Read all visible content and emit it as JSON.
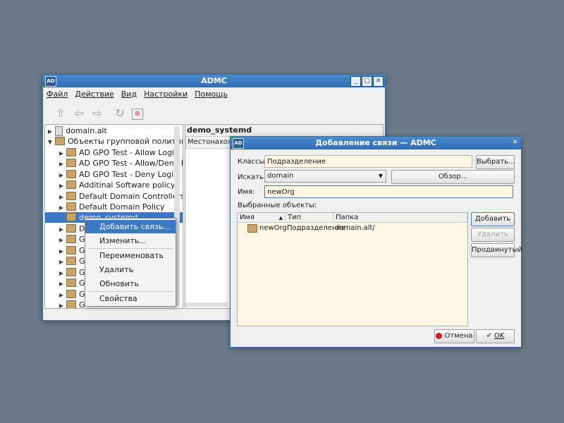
{
  "main_window": {
    "icon": "AD",
    "title": "ADMC",
    "controls": [
      "minimize",
      "maximize",
      "close"
    ],
    "menu": [
      "Файл",
      "Действие",
      "Вид",
      "Настройки",
      "Помощь"
    ],
    "toolbar": [
      "up-arrow-icon",
      "back-arrow-icon",
      "forward-arrow-icon",
      "refresh-icon",
      "filter-icon"
    ],
    "tree": {
      "root": "domain.alt",
      "group": "Объекты групповой политики",
      "items": [
        "AD GPO Test - Allow Login",
        "AD GPO Test - Allow/Deny L...",
        "AD GPO Test - Deny Login",
        "Additinal Software policy",
        "Default Domain Controllers...",
        "Default Domain Policy",
        "demo_systemd"
      ],
      "partial_items": [
        "D",
        "G",
        "G",
        "G",
        "G",
        "G",
        "G",
        "G"
      ]
    },
    "right_panel": {
      "title": "demo_systemd",
      "column": "Местонахож"
    }
  },
  "context_menu": {
    "items": [
      "Добавить связь...",
      "Изменить...",
      "Переименовать",
      "Удалить",
      "Обновить",
      "Свойства"
    ]
  },
  "dialog": {
    "icon": "AD",
    "title": "Добавление связи — ADMC",
    "classes_label": "Классы:",
    "classes_value": "Подразделение",
    "select_button": "Выбрать...",
    "search_in_label": "Искать в:",
    "search_in_value": "domain",
    "browse_button": "Обзор...",
    "name_label": "Имя:",
    "name_value": "newOrg",
    "selected_label": "Выбранные объекты:",
    "columns": [
      "Имя",
      "Тип",
      "Папка"
    ],
    "rows": [
      {
        "name": "newOrg",
        "type": "Подразделение",
        "folder": "domain.alt/"
      }
    ],
    "add_button": "Добавить",
    "remove_button": "Удалить",
    "advanced_button": "Продвинутый",
    "cancel_button": "Отмена",
    "ok_button": "OK"
  }
}
